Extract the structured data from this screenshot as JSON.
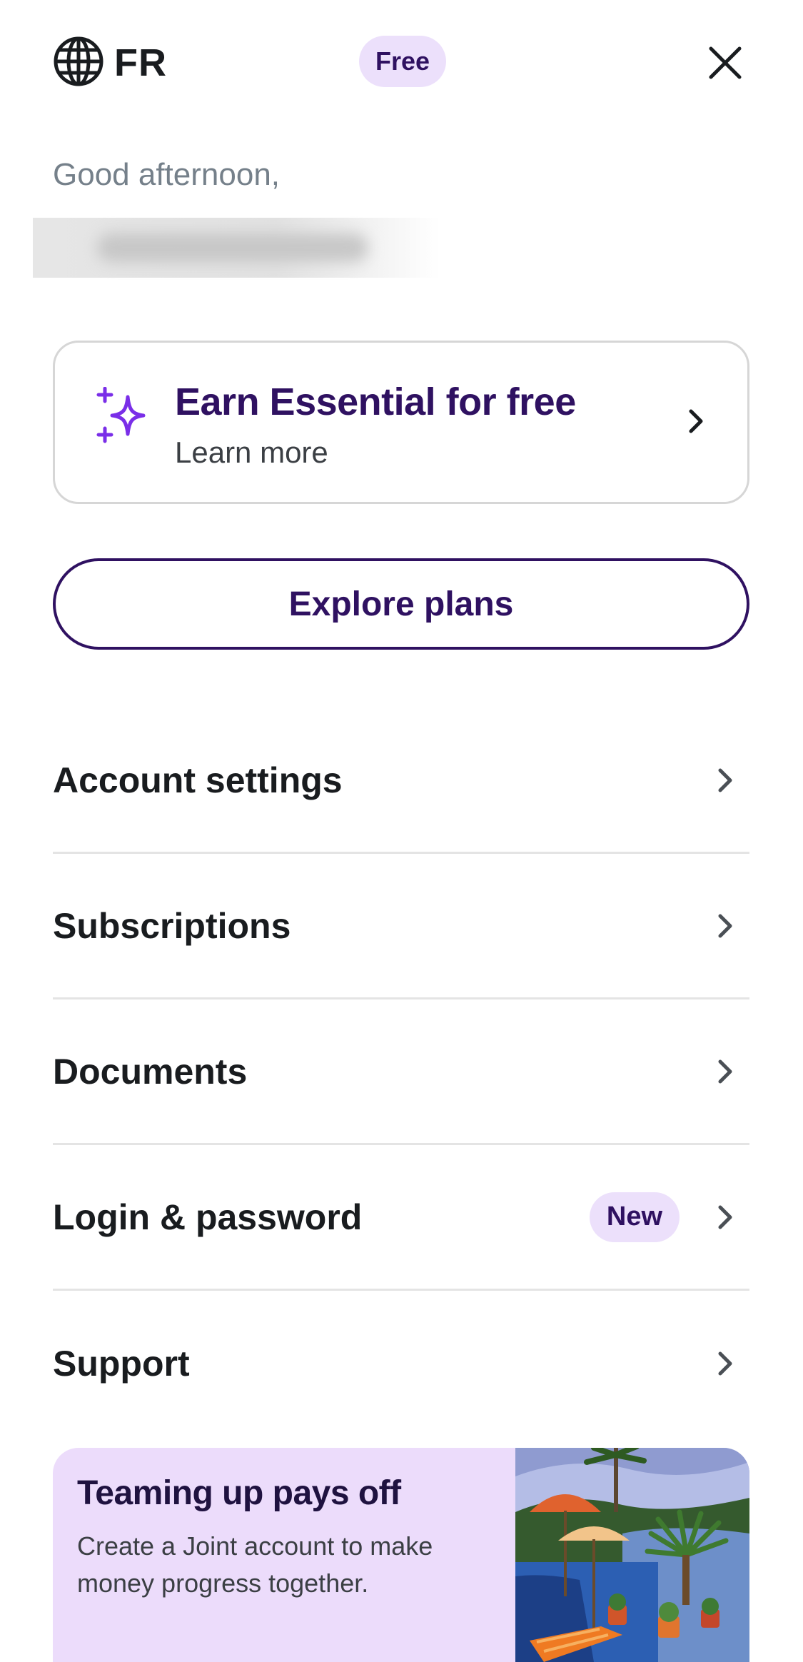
{
  "header": {
    "language_code": "FR",
    "plan_badge": "Free"
  },
  "greeting": {
    "text": "Good afternoon,"
  },
  "promo_card": {
    "title": "Earn Essential for free",
    "subtitle": "Learn more"
  },
  "explore_button": {
    "label": "Explore plans"
  },
  "menu": {
    "items": [
      {
        "label": "Account settings"
      },
      {
        "label": "Subscriptions"
      },
      {
        "label": "Documents"
      },
      {
        "label": "Login & password",
        "badge": "New"
      },
      {
        "label": "Support"
      }
    ]
  },
  "banner": {
    "title": "Teaming up pays off",
    "text": "Create a Joint account to make money progress together."
  },
  "colors": {
    "brand_dark": "#2f1161",
    "badge_bg": "#ece0fb",
    "sparkle": "#7a2ee8",
    "banner_bg": "#ecdcfb"
  }
}
